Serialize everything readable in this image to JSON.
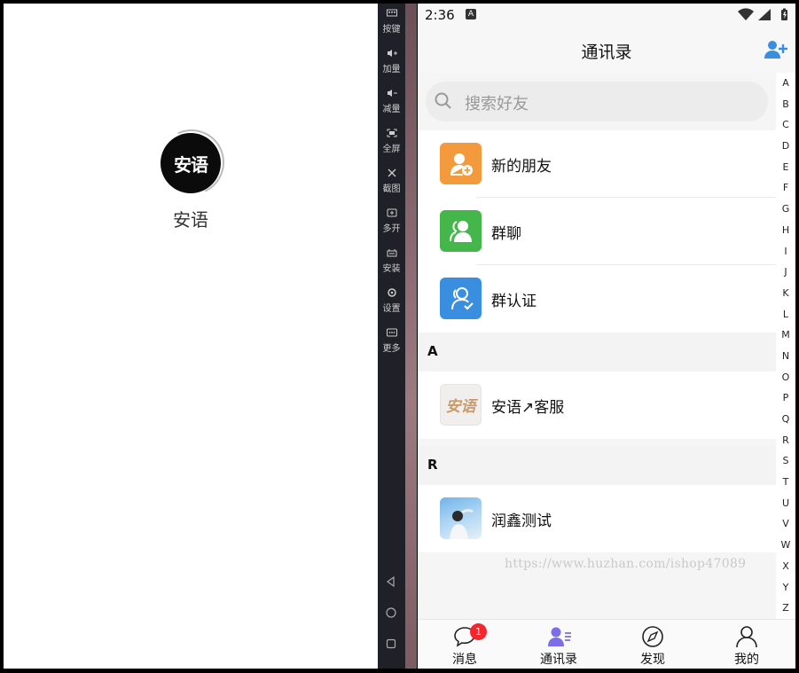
{
  "launcher": {
    "app_name": "安语",
    "logo_text": "安语"
  },
  "emulator_toolbar": {
    "items": [
      {
        "label": "按键",
        "icon": "keyboard-icon"
      },
      {
        "label": "加量",
        "icon": "volume-up-icon"
      },
      {
        "label": "减量",
        "icon": "volume-down-icon"
      },
      {
        "label": "全屏",
        "icon": "fullscreen-icon"
      },
      {
        "label": "截图",
        "icon": "scissors-icon"
      },
      {
        "label": "多开",
        "icon": "multi-instance-icon"
      },
      {
        "label": "安装",
        "icon": "install-icon"
      },
      {
        "label": "设置",
        "icon": "gear-icon"
      },
      {
        "label": "更多",
        "icon": "more-icon"
      }
    ]
  },
  "status_bar": {
    "time": "2:36",
    "notification_letter": "A"
  },
  "header": {
    "title": "通讯录"
  },
  "search": {
    "placeholder": "搜索好友"
  },
  "functions": [
    {
      "label": "新的朋友",
      "color": "#f39a3c",
      "icon": "new-friend-icon"
    },
    {
      "label": "群聊",
      "color": "#45b649",
      "icon": "group-chat-icon"
    },
    {
      "label": "群认证",
      "color": "#3a8ee0",
      "icon": "group-verify-icon"
    }
  ],
  "sections": [
    {
      "letter": "A",
      "contacts": [
        {
          "name": "安语↗客服",
          "avatar_text": "安语"
        }
      ]
    },
    {
      "letter": "R",
      "contacts": [
        {
          "name": "润鑫测试"
        }
      ]
    }
  ],
  "watermark": "https://www.huzhan.com/ishop47089",
  "alphabet": [
    "A",
    "B",
    "C",
    "D",
    "E",
    "F",
    "G",
    "H",
    "I",
    "J",
    "K",
    "L",
    "M",
    "N",
    "O",
    "P",
    "Q",
    "R",
    "S",
    "T",
    "U",
    "V",
    "W",
    "X",
    "Y",
    "Z"
  ],
  "tabs": [
    {
      "label": "消息",
      "icon": "chat-bubble-icon",
      "badge": "1"
    },
    {
      "label": "通讯录",
      "icon": "contacts-icon"
    },
    {
      "label": "发现",
      "icon": "compass-icon"
    },
    {
      "label": "我的",
      "icon": "user-icon"
    }
  ],
  "colors": {
    "accent": "#7b6ee6",
    "badge": "#f3262d"
  }
}
